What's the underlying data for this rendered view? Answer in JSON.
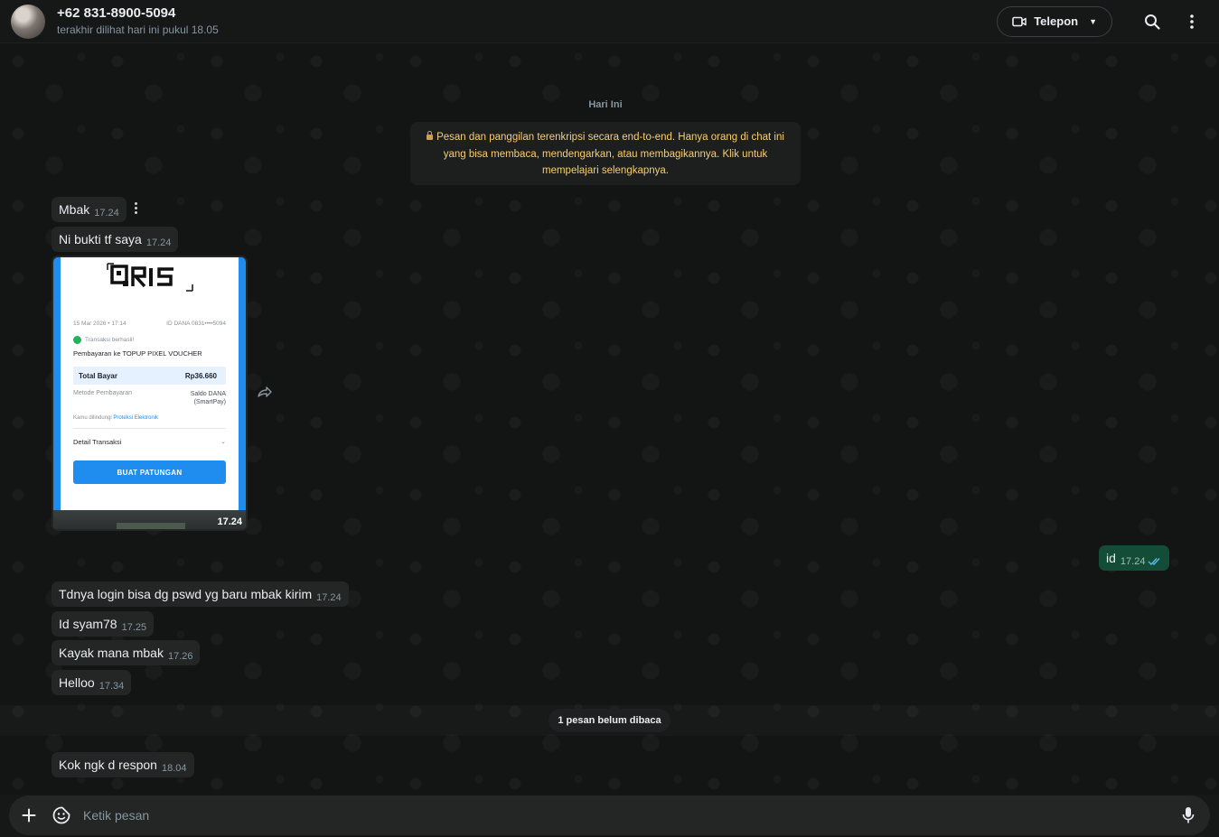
{
  "header": {
    "contact_name": "+62 831-8900-5094",
    "contact_status": "terakhir dilihat hari ini pukul 18.05",
    "call_label": "Telepon"
  },
  "chat": {
    "date_label": "Hari Ini",
    "encryption_notice": "Pesan dan panggilan terenkripsi secara end-to-end. Hanya orang di chat ini yang bisa membaca, mendengarkan, atau membagikannya. Klik untuk mempelajari selengkapnya.",
    "messages": [
      {
        "text": "Mbak",
        "time": "17.24"
      },
      {
        "text": "Ni bukti tf saya",
        "time": "17.24"
      },
      {
        "text": "id",
        "time": "17.24"
      },
      {
        "text": "Tdnya login bisa dg pswd yg baru mbak kirim",
        "time": "17.24"
      },
      {
        "text": "Id syam78",
        "time": "17.25"
      },
      {
        "text": "Kayak mana mbak",
        "time": "17.26"
      },
      {
        "text": "Helloo",
        "time": "17.34"
      },
      {
        "text": "Kok ngk d respon",
        "time": "18.04"
      }
    ],
    "image_message": {
      "time": "17.24",
      "receipt": {
        "date": "15 Mar 2026 • 17:14",
        "account_id": "ID DANA 0831••••5094",
        "status": "Transaksi berhasil!",
        "title": "Pembayaran ke TOPUP PIXEL VOUCHER",
        "total_label": "Total Bayar",
        "total_value": "Rp36.660",
        "method_label": "Metode Pembayaran",
        "method_value_1": "Saldo DANA",
        "method_value_2": "(SmartPay)",
        "protection_text": "Kamu dilindungi",
        "protection_link": "Proteksi Elektronik",
        "detail_label": "Detail Transaksi",
        "button_label": "BUAT PATUNGAN"
      }
    },
    "unread_label": "1 pesan belum dibaca"
  },
  "composer": {
    "placeholder": "Ketik pesan"
  },
  "colors": {
    "incoming_bubble": "#242626",
    "outgoing_bubble": "#144d37",
    "notice_text": "#f7cd73",
    "read_ticks": "#53bdeb"
  }
}
